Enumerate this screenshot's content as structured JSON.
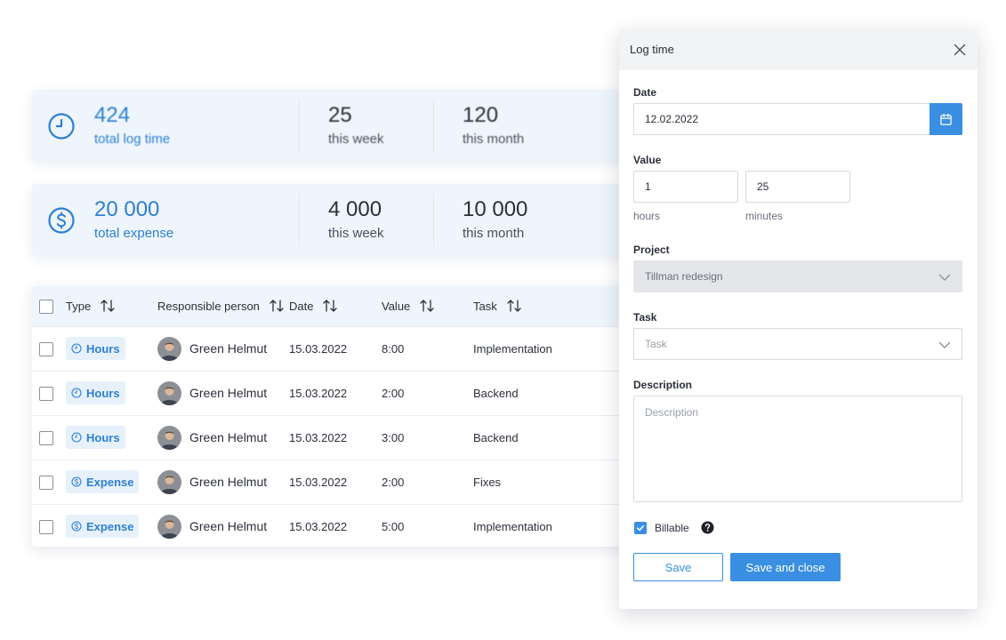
{
  "stats_time": {
    "icon": "clock-icon",
    "main_value": "424",
    "main_label": "total log time",
    "week_value": "25",
    "week_label": "this week",
    "month_value": "120",
    "month_label": "this month"
  },
  "stats_expense": {
    "icon": "dollar-icon",
    "main_value": "20 000",
    "main_label": "total expense",
    "week_value": "4 000",
    "week_label": "this week",
    "month_value": "10 000",
    "month_label": "this month"
  },
  "table": {
    "columns": [
      "Type",
      "Responsible person",
      "Date",
      "Value",
      "Task"
    ],
    "rows": [
      {
        "type": "Hours",
        "type_icon": "clock-icon",
        "person": "Green Helmut",
        "date": "15.03.2022",
        "value": "8:00",
        "task": "Implementation"
      },
      {
        "type": "Hours",
        "type_icon": "clock-icon",
        "person": "Green Helmut",
        "date": "15.03.2022",
        "value": "2:00",
        "task": "Backend"
      },
      {
        "type": "Hours",
        "type_icon": "clock-icon",
        "person": "Green Helmut",
        "date": "15.03.2022",
        "value": "3:00",
        "task": "Backend"
      },
      {
        "type": "Expense",
        "type_icon": "dollar-icon",
        "person": "Green Helmut",
        "date": "15.03.2022",
        "value": "2:00",
        "task": "Fixes"
      },
      {
        "type": "Expense",
        "type_icon": "dollar-icon",
        "person": "Green Helmut",
        "date": "15.03.2022",
        "value": "5:00",
        "task": "Implementation"
      }
    ]
  },
  "dialog": {
    "title": "Log time",
    "date_label": "Date",
    "date_value": "12.02.2022",
    "value_label": "Value",
    "hours_value": "1",
    "minutes_value": "25",
    "hours_label": "hours",
    "minutes_label": "minutes",
    "project_label": "Project",
    "project_value": "Tillman redesign",
    "task_label": "Task",
    "task_placeholder": "Task",
    "description_label": "Description",
    "description_placeholder": "Description",
    "billable_label": "Billable",
    "billable_checked": true,
    "save_label": "Save",
    "save_close_label": "Save and close"
  },
  "colors": {
    "accent": "#3a8fe2",
    "accent_text": "#2d7fd4",
    "card_bg": "#eef5fc"
  }
}
